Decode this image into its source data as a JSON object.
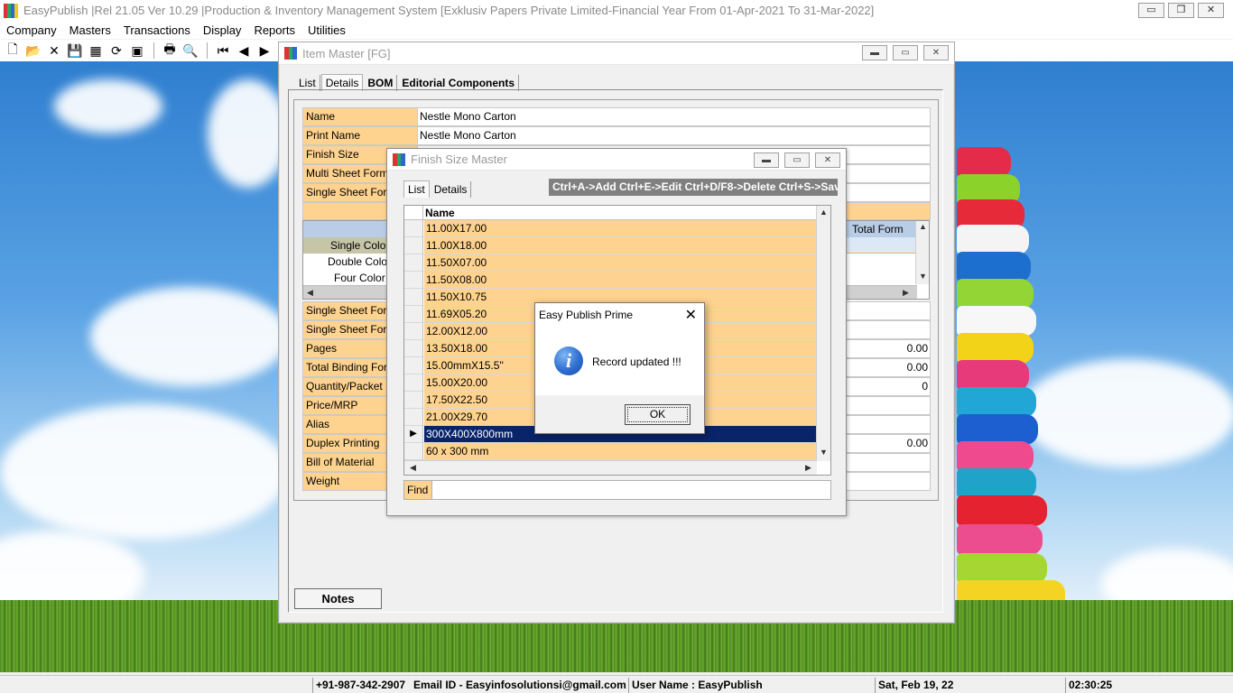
{
  "app": {
    "title": "EasyPublish |Rel 21.05 Ver 10.29 |Production & Inventory Management System [Exklusiv Papers Private Limited-Financial Year From 01-Apr-2021 To 31-Mar-2022]",
    "window_buttons": [
      "▭",
      "❐",
      "✕"
    ]
  },
  "menu": [
    "Company",
    "Masters",
    "Transactions",
    "Display",
    "Reports",
    "Utilities"
  ],
  "toolbar": {
    "icons": [
      "new-icon",
      "open-icon",
      "delete-icon",
      "save-icon",
      "export-icon",
      "refresh-icon",
      "calculator-icon",
      "print-icon",
      "print-preview-icon",
      "first-record-icon",
      "previous-record-icon",
      "next-record-icon",
      "last-record-icon"
    ],
    "glyphs": [
      "🗋",
      "📂",
      "✕",
      "💾",
      "▦",
      "⟳",
      "▣",
      "🖶",
      "🔍",
      "⏮",
      "◀",
      "▶",
      "⏭"
    ]
  },
  "item_master": {
    "title": "Item Master [FG]",
    "tabs": [
      "List",
      "Details",
      "BOM",
      "Editorial Components"
    ],
    "active_tab": "Details",
    "fields": [
      {
        "label": "Name",
        "value": "Nestle Mono Carton"
      },
      {
        "label": "Print Name",
        "value": "Nestle Mono Carton"
      },
      {
        "label": "Finish Size",
        "value": ""
      },
      {
        "label": "Multi Sheet Form",
        "value": ""
      },
      {
        "label": "Single Sheet Form",
        "value": ""
      }
    ],
    "subgrid": {
      "col_header_right": "Total Form",
      "rows": [
        "Single Color",
        "Double Color",
        "Four Color"
      ]
    },
    "fields2": [
      {
        "label": "Single Sheet Form",
        "value": ""
      },
      {
        "label": "Single Sheet Form",
        "value": ""
      },
      {
        "label": "Pages",
        "value": "0.00"
      },
      {
        "label": "Total Binding Form",
        "value": "0.00"
      },
      {
        "label": "Quantity/Packet",
        "value": "0"
      },
      {
        "label": "Price/MRP",
        "value": ""
      },
      {
        "label": "Alias",
        "value": ""
      },
      {
        "label": "Duplex Printing",
        "value": "0.00"
      },
      {
        "label": "Bill of Material",
        "value": ""
      },
      {
        "label": "Weight",
        "value": ""
      }
    ],
    "notes_label": "Notes"
  },
  "finish_size": {
    "title": "Finish Size Master",
    "tabs": [
      "List",
      "Details"
    ],
    "shortcuts": "Ctrl+A->Add  Ctrl+E->Edit  Ctrl+D/F8->Delete  Ctrl+S->Save",
    "column": "Name",
    "rows": [
      "11.00X17.00",
      "11.00X18.00",
      "11.50X07.00",
      "11.50X08.00",
      "11.50X10.75",
      "11.69X05.20",
      "12.00X12.00",
      "13.50X18.00",
      "15.00mmX15.5''",
      "15.00X20.00",
      "17.50X22.50",
      "21.00X29.70",
      "300X400X800mm",
      "60 x 300 mm"
    ],
    "selected_row": "300X400X800mm",
    "find_label": "Find",
    "find_value": ""
  },
  "message_box": {
    "title": "Easy Publish Prime",
    "icon": "info-icon",
    "message": "Record updated !!!",
    "ok_label": "OK"
  },
  "status": {
    "phone": "+91-987-342-2907",
    "email": "Email ID - Easyinfosolutionsi@gmail.com",
    "user": "User Name : EasyPublish",
    "date": "Sat, Feb 19, 22",
    "time": "02:30:25"
  },
  "colors": {
    "label_bg": "#fed38f",
    "selected_row_bg": "#0a246a",
    "shortcut_bar_bg": "#808080"
  }
}
